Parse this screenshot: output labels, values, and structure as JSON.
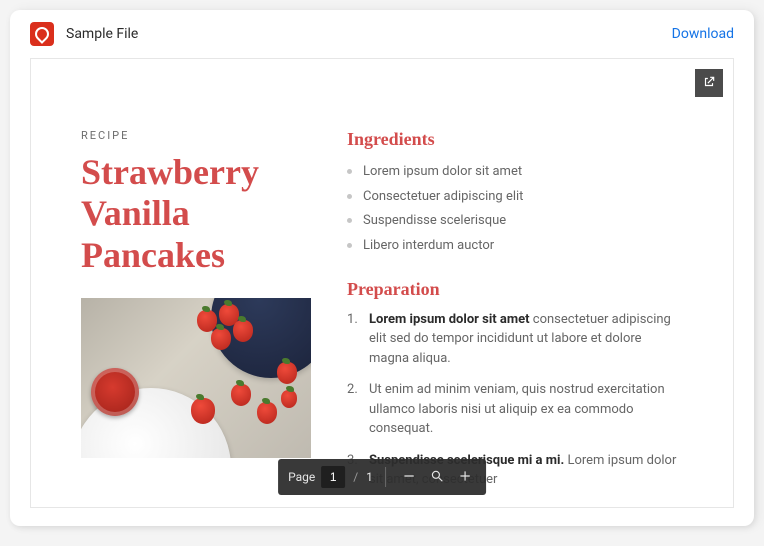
{
  "topbar": {
    "file_label": "Sample File",
    "download_label": "Download"
  },
  "document": {
    "overline": "RECIPE",
    "title": "Strawberry Vanilla Pancakes",
    "sections": {
      "ingredients": {
        "heading": "Ingredients",
        "items": [
          "Lorem ipsum dolor sit amet",
          "Consectetuer adipiscing elit",
          "Suspendisse scelerisque",
          "Libero interdum auctor"
        ]
      },
      "preparation": {
        "heading": "Preparation",
        "steps": [
          {
            "lead": "Lorem ipsum dolor sit amet",
            "body": " consectetuer adipiscing elit sed do tempor incididunt ut labore et dolore magna aliqua."
          },
          {
            "lead": "",
            "body": "Ut enim ad minim veniam, quis nostrud exercitation ullamco laboris nisi ut aliquip ex ea commodo consequat."
          },
          {
            "lead": "Suspendisse scelerisque mi a mi.",
            "body": " Lorem ipsum dolor sit amet, consectetuer"
          }
        ]
      }
    }
  },
  "toolbar": {
    "page_label": "Page",
    "page_current": "1",
    "page_sep": "/",
    "page_total": "1"
  }
}
